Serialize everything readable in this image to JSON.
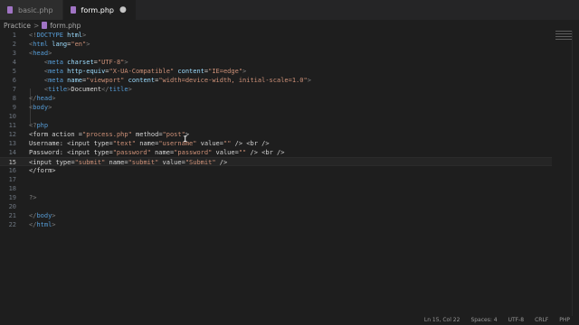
{
  "tabs": [
    {
      "label": "basic.php",
      "active": false
    },
    {
      "label": "form.php",
      "active": true,
      "modified": true
    }
  ],
  "breadcrumb": {
    "folder": "Practice",
    "file": "form.php",
    "separator": ">"
  },
  "code_lines": [
    {
      "n": "1",
      "tokens": [
        {
          "t": "<!",
          "c": "p"
        },
        {
          "t": "DOCTYPE",
          "c": "t"
        },
        {
          "t": " html",
          "c": "a"
        },
        {
          "t": ">",
          "c": "p"
        }
      ]
    },
    {
      "n": "2",
      "tokens": [
        {
          "t": "<",
          "c": "p"
        },
        {
          "t": "html",
          "c": "t"
        },
        {
          "t": " lang",
          "c": "a"
        },
        {
          "t": "=",
          "c": ""
        },
        {
          "t": "\"en\"",
          "c": "s"
        },
        {
          "t": ">",
          "c": "p"
        }
      ]
    },
    {
      "n": "3",
      "tokens": [
        {
          "t": "<",
          "c": "p"
        },
        {
          "t": "head",
          "c": "t"
        },
        {
          "t": ">",
          "c": "p"
        }
      ]
    },
    {
      "n": "4",
      "tokens": [
        {
          "t": "    <",
          "c": "p"
        },
        {
          "t": "meta",
          "c": "t"
        },
        {
          "t": " charset",
          "c": "a"
        },
        {
          "t": "=",
          "c": ""
        },
        {
          "t": "\"UTF-8\"",
          "c": "s"
        },
        {
          "t": ">",
          "c": "p"
        }
      ]
    },
    {
      "n": "5",
      "tokens": [
        {
          "t": "    <",
          "c": "p"
        },
        {
          "t": "meta",
          "c": "t"
        },
        {
          "t": " http-equiv",
          "c": "a"
        },
        {
          "t": "=",
          "c": ""
        },
        {
          "t": "\"X-UA-Compatible\"",
          "c": "s"
        },
        {
          "t": " content",
          "c": "a"
        },
        {
          "t": "=",
          "c": ""
        },
        {
          "t": "\"IE=edge\"",
          "c": "s"
        },
        {
          "t": ">",
          "c": "p"
        }
      ]
    },
    {
      "n": "6",
      "tokens": [
        {
          "t": "    <",
          "c": "p"
        },
        {
          "t": "meta",
          "c": "t"
        },
        {
          "t": " name",
          "c": "a"
        },
        {
          "t": "=",
          "c": ""
        },
        {
          "t": "\"viewport\"",
          "c": "s"
        },
        {
          "t": " content",
          "c": "a"
        },
        {
          "t": "=",
          "c": ""
        },
        {
          "t": "\"width=device-width, initial-scale=1.0\"",
          "c": "s"
        },
        {
          "t": ">",
          "c": "p"
        }
      ]
    },
    {
      "n": "7",
      "tokens": [
        {
          "t": "    <",
          "c": "p"
        },
        {
          "t": "title",
          "c": "t"
        },
        {
          "t": ">",
          "c": "p"
        },
        {
          "t": "Document",
          "c": ""
        },
        {
          "t": "</",
          "c": "p"
        },
        {
          "t": "title",
          "c": "t"
        },
        {
          "t": ">",
          "c": "p"
        }
      ]
    },
    {
      "n": "8",
      "tokens": [
        {
          "t": "</",
          "c": "p"
        },
        {
          "t": "head",
          "c": "t"
        },
        {
          "t": ">",
          "c": "p"
        }
      ]
    },
    {
      "n": "9",
      "tokens": [
        {
          "t": "<",
          "c": "p"
        },
        {
          "t": "body",
          "c": "t"
        },
        {
          "t": ">",
          "c": "p"
        }
      ]
    },
    {
      "n": "10",
      "tokens": []
    },
    {
      "n": "11",
      "tokens": [
        {
          "t": "<?",
          "c": "p"
        },
        {
          "t": "php",
          "c": "t"
        }
      ]
    },
    {
      "n": "12",
      "tokens": [
        {
          "t": "<form action =",
          "c": ""
        },
        {
          "t": "\"process.php\"",
          "c": "s"
        },
        {
          "t": " method=",
          "c": ""
        },
        {
          "t": "\"post\"",
          "c": "s"
        },
        {
          "t": ">",
          "c": ""
        }
      ]
    },
    {
      "n": "13",
      "tokens": [
        {
          "t": "Username: <input type=",
          "c": ""
        },
        {
          "t": "\"text\"",
          "c": "s"
        },
        {
          "t": " name=",
          "c": ""
        },
        {
          "t": "\"username\"",
          "c": "s"
        },
        {
          "t": " value=",
          "c": ""
        },
        {
          "t": "\"\"",
          "c": "s"
        },
        {
          "t": " /> <br />",
          "c": ""
        }
      ]
    },
    {
      "n": "14",
      "tokens": [
        {
          "t": "Password: <input type=",
          "c": ""
        },
        {
          "t": "\"password\"",
          "c": "s"
        },
        {
          "t": " name=",
          "c": ""
        },
        {
          "t": "\"password\"",
          "c": "s"
        },
        {
          "t": " value=",
          "c": ""
        },
        {
          "t": "\"\"",
          "c": "s"
        },
        {
          "t": " /> <br />",
          "c": ""
        }
      ]
    },
    {
      "n": "15",
      "current": true,
      "tokens": [
        {
          "t": "<input type=",
          "c": ""
        },
        {
          "t": "\"submit\"",
          "c": "s"
        },
        {
          "t": " name=",
          "c": ""
        },
        {
          "t": "\"submit\"",
          "c": "s"
        },
        {
          "t": " value=",
          "c": ""
        },
        {
          "t": "\"Submit\"",
          "c": "s"
        },
        {
          "t": " />",
          "c": ""
        }
      ]
    },
    {
      "n": "16",
      "tokens": [
        {
          "t": "</form>",
          "c": ""
        }
      ]
    },
    {
      "n": "17",
      "tokens": []
    },
    {
      "n": "18",
      "tokens": []
    },
    {
      "n": "19",
      "tokens": [
        {
          "t": "?>",
          "c": "p"
        }
      ]
    },
    {
      "n": "20",
      "tokens": []
    },
    {
      "n": "21",
      "tokens": [
        {
          "t": "</",
          "c": "p"
        },
        {
          "t": "body",
          "c": "t"
        },
        {
          "t": ">",
          "c": "p"
        }
      ]
    },
    {
      "n": "22",
      "tokens": [
        {
          "t": "</",
          "c": "p"
        },
        {
          "t": "html",
          "c": "t"
        },
        {
          "t": ">",
          "c": "p"
        }
      ]
    }
  ],
  "status": {
    "position": "Ln 15, Col 22",
    "spaces": "Spaces: 4",
    "encoding": "UTF-8",
    "eol": "CRLF",
    "language": "PHP"
  },
  "icons": {
    "php": "php-file-icon",
    "modified": "modified-dot-icon",
    "close": "close-icon",
    "chevron": "chevron-right-icon"
  },
  "colors": {
    "background": "#1e1e1e",
    "tag": "#569cd6",
    "attribute": "#9cdcfe",
    "string": "#ce9178"
  }
}
